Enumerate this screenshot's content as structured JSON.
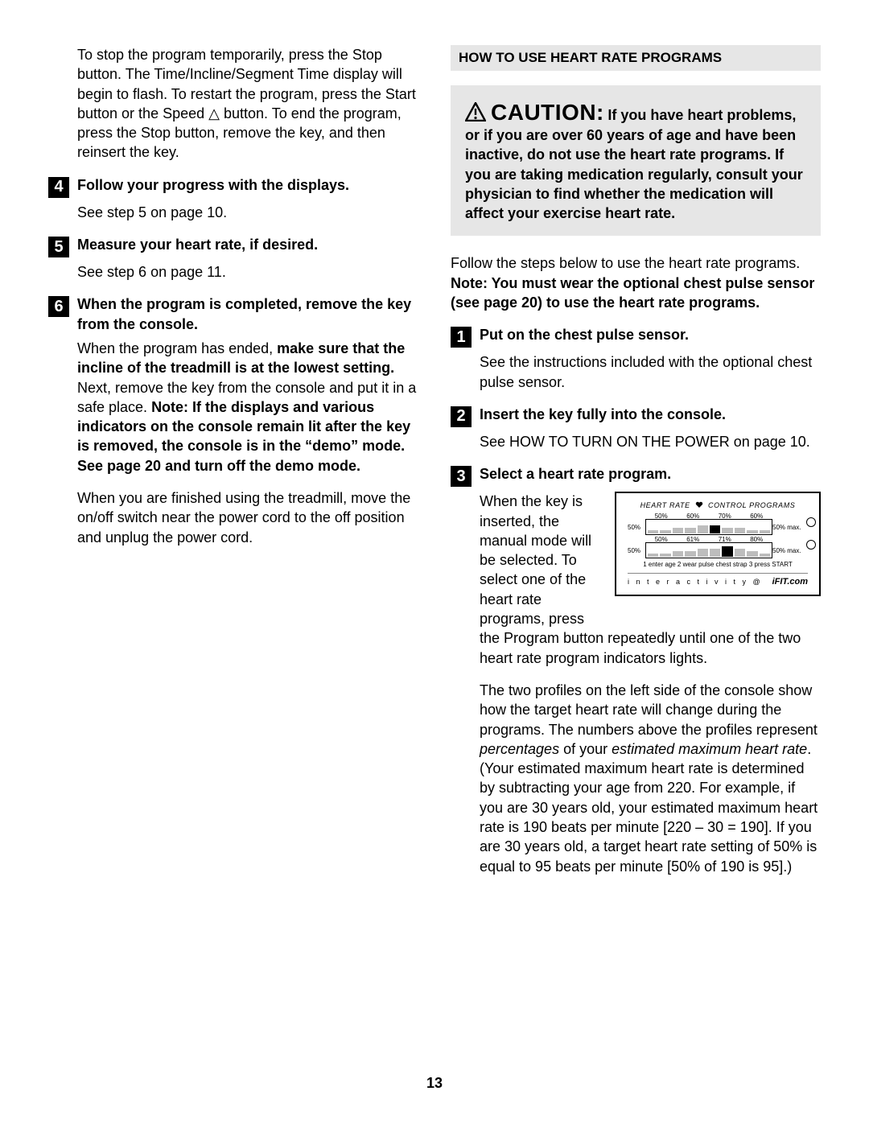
{
  "page_number": "13",
  "left_column": {
    "intro_para": "To stop the program temporarily, press the Stop button. The Time/Incline/Segment Time display will begin to flash. To restart the program, press the Start button or the Speed △ button. To end the program, press the Stop button, remove the key, and then reinsert the key.",
    "steps": {
      "s4": {
        "num": "4",
        "title": "Follow your progress with the displays.",
        "body": "See step 5 on page 10."
      },
      "s5": {
        "num": "5",
        "title": "Measure your heart rate, if desired.",
        "body": "See step 6 on page 11."
      },
      "s6": {
        "num": "6",
        "title": "When the program is completed, remove the key from the console.",
        "body_1a": "When the program has ended, ",
        "body_1b_bold": "make sure that the incline of the treadmill is at the lowest setting.",
        "body_1c": " Next, remove the key from the console and put it in a safe place. ",
        "body_1d_bold": "Note: If the displays and various indicators on the console remain lit after the key is removed, the console is in the “demo” mode. See page 20 and turn off the demo mode.",
        "body_2": "When you are finished using the treadmill, move the on/off switch near the power cord to the off position and unplug the power cord."
      }
    }
  },
  "right_column": {
    "section_heading": "HOW TO USE HEART RATE PROGRAMS",
    "caution": {
      "word": "CAUTION:",
      "text": "If you have heart problems, or if you are over 60 years of age and have been inactive, do not use the heart rate programs. If you are taking medication regularly, consult your physician to find whether the medication will affect your exercise heart rate."
    },
    "lead_para_a": "Follow the steps below to use the heart rate programs. ",
    "lead_para_bold": "Note: You must wear the optional chest pulse sensor (see page 20) to use the heart rate programs.",
    "steps": {
      "s1": {
        "num": "1",
        "title": "Put on the chest pulse sensor.",
        "body": "See the instructions included with the optional chest pulse sensor."
      },
      "s2": {
        "num": "2",
        "title": "Insert the key fully into the console.",
        "body": "See HOW TO TURN ON THE POWER on page 10."
      },
      "s3": {
        "num": "3",
        "title": "Select a heart rate program.",
        "side_text": "When the key is inserted, the manual mode will be selected. To select one of the heart rate programs, press ",
        "follow_on": "the Program button repeatedly until one of the two heart rate program indicators lights.",
        "explain_a": "The two profiles on the left side of the console show how the target heart rate will change during the programs. The numbers above the profiles represent ",
        "explain_italic1": "percentages",
        "explain_b": " of your ",
        "explain_italic2": "estimated maximum heart rate",
        "explain_c": ". (Your estimated maximum heart rate is determined by subtracting your age from 220. For example, if you are 30 years old, your estimated maximum heart rate is 190 beats per minute  [220 – 30 = 190]. If you are 30 years old, a target heart rate setting of 50% is equal to 95 beats per minute [50% of 190 is 95].)"
      }
    },
    "console": {
      "title_a": "HEART RATE",
      "title_b": "CONTROL PROGRAMS",
      "row1_pcts": [
        "50%",
        "60%",
        "70%",
        "60%"
      ],
      "row1_suffix": "50% max.",
      "row2_pcts": [
        "50%",
        "61%",
        "71%",
        "80%"
      ],
      "row2_suffix": "50% max.",
      "instruction": "1 enter age  2 wear pulse chest strap  3 press START",
      "interactivity": "i n t e r a c t i v i t y  @",
      "brand": "iFIT.com"
    }
  }
}
